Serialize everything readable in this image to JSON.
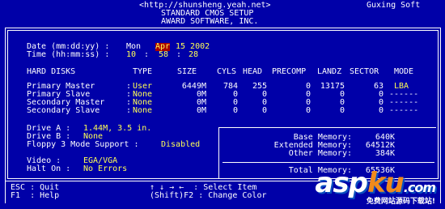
{
  "header": {
    "url": "<http://shunsheng.yeah.net>",
    "brand": "Guxing Soft",
    "title1": "STANDARD CMOS SETUP",
    "title2": "AWARD SOFTWARE, INC."
  },
  "datetime": {
    "date_label": "Date (mm:dd:yy) :",
    "day": "Mon",
    "month": "Apr",
    "date": "15 2002",
    "time_label": "Time (hh:mm:ss) :",
    "hour": "10",
    "minute": "58",
    "second": "28"
  },
  "disks": {
    "columns": [
      "HARD DISKS",
      "TYPE",
      "SIZE",
      "CYLS",
      "HEAD",
      "PRECOMP",
      "LANDZ",
      "SECTOR",
      "MODE"
    ],
    "rows": [
      {
        "name": "Primary Master",
        "type": "User",
        "size": "6449M",
        "cyls": "784",
        "head": "255",
        "precomp": "0",
        "landz": "13175",
        "sector": "63",
        "mode": "LBA"
      },
      {
        "name": "Primary Slave",
        "type": "None",
        "size": "0M",
        "cyls": "0",
        "head": "0",
        "precomp": "0",
        "landz": "0",
        "sector": "0",
        "mode": "------"
      },
      {
        "name": "Secondary Master",
        "type": "None",
        "size": "0M",
        "cyls": "0",
        "head": "0",
        "precomp": "0",
        "landz": "0",
        "sector": "0",
        "mode": "------"
      },
      {
        "name": "Secondary Slave",
        "type": "None",
        "size": "0M",
        "cyls": "0",
        "head": "0",
        "precomp": "0",
        "landz": "0",
        "sector": "0",
        "mode": "------"
      }
    ]
  },
  "drives": {
    "drive_a_label": "Drive A :",
    "drive_a_value": "1.44M, 3.5 in.",
    "drive_b_label": "Drive B :",
    "drive_b_value": "None",
    "floppy_label": "Floppy 3 Mode Support :",
    "floppy_value": "Disabled",
    "video_label": "Video :",
    "video_value": "EGA/VGA",
    "halt_label": "Halt On :",
    "halt_value": "No Errors"
  },
  "memory": {
    "base_label": "Base Memory:",
    "base_value": "640K",
    "ext_label": "Extended Memory:",
    "ext_value": "64512K",
    "other_label": "Other Memory:",
    "other_value": "384K",
    "total_label": "Total Memory:",
    "total_value": "65536K"
  },
  "footer": {
    "esc": "ESC : Quit",
    "f1": "F1  : Help",
    "arrows": "↑ ↓ → ←  : Select Item",
    "shift_f2": "(Shift)F2 : Change Color"
  },
  "watermark": {
    "asp": "asp",
    "ku": "ku",
    "dot_com": ".com",
    "sub": "免费网站源码下载站!"
  },
  "colors": {
    "background": "#0000a8",
    "text": "#ffffff",
    "value": "#ffff55",
    "selection": "#a80000"
  }
}
